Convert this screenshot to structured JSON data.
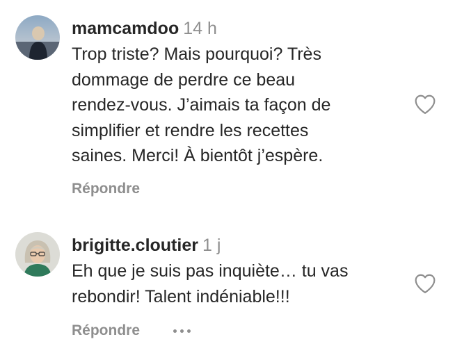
{
  "comments": [
    {
      "username": "mamcamdoo",
      "time": "14 h",
      "lines": [
        "Trop triste? Mais pourquoi? Très",
        "dommage de perdre ce beau",
        "rendez-vous. J’aimais ta façon de",
        "simplifier et rendre les recettes",
        "saines. Merci! À bientôt j’espère."
      ],
      "reply_label": "Répondre",
      "like_icon": "heart-outline-icon"
    },
    {
      "username": "brigitte.cloutier",
      "time": "1 j",
      "lines": [
        "Eh que je suis pas inquiète… tu vas",
        "rebondir! Talent indéniable!!!"
      ],
      "reply_label": "Répondre",
      "more_icon": "more-options-icon",
      "like_icon": "heart-outline-icon"
    }
  ],
  "colors": {
    "text": "#262626",
    "secondary": "#8e8e8e"
  }
}
